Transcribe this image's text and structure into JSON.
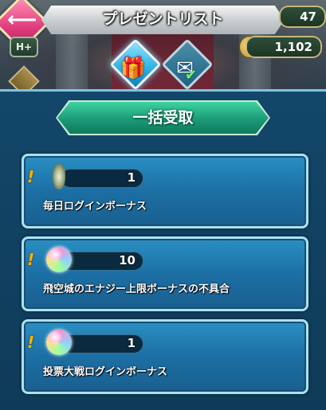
{
  "header": {
    "title": "プレゼントリスト",
    "back_icon": "back-arrow-icon",
    "counter_top_value": "47",
    "orb_count": "1,102",
    "left_badge_label": "H+"
  },
  "tabs": [
    {
      "name": "gift-tab",
      "icon": "gift-icon",
      "selected": true
    },
    {
      "name": "claimed-tab",
      "icon": "claimed-check-icon",
      "selected": false
    }
  ],
  "claim_all_label": "一括受取",
  "presents": [
    {
      "quantity": "1",
      "label": "毎日ログインボーナス",
      "icon": "feather-icon"
    },
    {
      "quantity": "10",
      "label": "飛空城のエナジー上限ボーナスの不具合",
      "icon": "orb-icon"
    },
    {
      "quantity": "1",
      "label": "投票大戦ログインボーナス",
      "icon": "orb-icon"
    }
  ],
  "colors": {
    "accent_pink": "#e03a7b",
    "panel_blue": "#1c6fa4",
    "claim_green": "#1b9a77",
    "alert_orange": "#ffb000"
  }
}
